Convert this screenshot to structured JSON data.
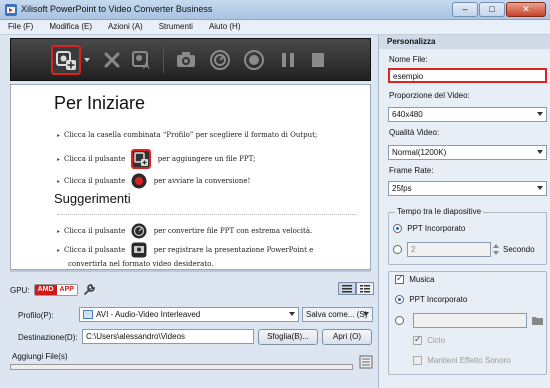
{
  "window": {
    "title": "Xilisoft PowerPoint to Video Converter Business",
    "controls": [
      "–",
      "□",
      "✕"
    ]
  },
  "menu": [
    {
      "label": "File (F)"
    },
    {
      "label": "Modifica (E)"
    },
    {
      "label": "Azioni (A)"
    },
    {
      "label": "Strumenti"
    },
    {
      "label": "Aiuto (H)"
    }
  ],
  "content": {
    "heading": "Per Iniziare",
    "line1": "Clicca la casella combinata “Profilo” per scegliere il formato di Output;",
    "line2_pre": "Clicca il pulsante",
    "line2_post": "per aggiungere un file PPT;",
    "line3_pre": "Clicca il pulsante",
    "line3_post": "per avviare la conversione!",
    "subheading": "Suggerimenti",
    "line4_pre": "Clicca il pulsante",
    "line4_post": "per convertire file PPT con estrema velocità.",
    "line5_pre": "Clicca il pulsante",
    "line5_post": "per registrare la presentazione PowerPoint e",
    "line5_cont": "convertirla nel formato video desiderato."
  },
  "gpu": {
    "label": "GPU:",
    "badge_brand": "AMD",
    "badge_text": "APP"
  },
  "profile": {
    "label": "Profilo(P):",
    "value": "AVI - Audio-Video Interleaved",
    "save_as": "Salva come... (S)"
  },
  "destination": {
    "label": "Destinazione(D):",
    "value": "C:\\Users\\alessandro\\Videos",
    "browse": "Sfoglia(B)...",
    "open": "Apri (O)"
  },
  "add_files": {
    "label": "Aggiungi File(s)",
    "progress": 0
  },
  "panel": {
    "section": "Personalizza",
    "filename_label": "Nome File:",
    "filename_value": "esempio",
    "size_label": "Proporzione del Video:",
    "size_value": "640x480",
    "quality_label": "Qualità Video:",
    "quality_value": "Normal(1200K)",
    "framerate_label": "Frame Rate:",
    "framerate_value": "25fps",
    "timing_group": "Tempo tra le diapositive",
    "timing_option1": "PPT Incorporato",
    "timing_seconds_value": "2",
    "timing_seconds_label": "Secondo",
    "music_label": "Musica",
    "music_option1": "PPT Incorporato",
    "music_loop": "Ciclo",
    "music_keep": "Mantieni Effetto Sonoro"
  },
  "colors": {
    "highlight": "#dd2222",
    "toolbar_bg": "#2a2a2a",
    "panel_bg": "#e8eef5"
  }
}
